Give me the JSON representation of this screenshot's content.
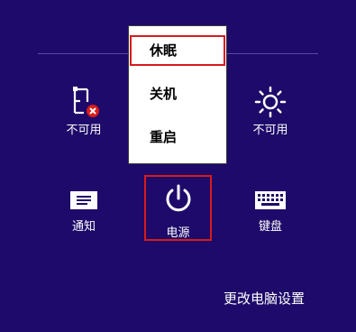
{
  "colors": {
    "background": "#1e0a6a",
    "highlight_border": "#d81b1b",
    "menu_bg": "#ffffff"
  },
  "tiles": {
    "network": {
      "label": "不可用",
      "icon": "network-unavailable-icon"
    },
    "brightness": {
      "label": "不可用",
      "icon": "brightness-icon"
    },
    "notifications": {
      "label": "通知",
      "icon": "notifications-icon"
    },
    "power": {
      "label": "电源",
      "icon": "power-icon"
    },
    "keyboard": {
      "label": "键盘",
      "icon": "keyboard-icon"
    }
  },
  "power_menu": {
    "items": [
      {
        "label": "休眠",
        "selected": true
      },
      {
        "label": "关机",
        "selected": false
      },
      {
        "label": "重启",
        "selected": false
      }
    ]
  },
  "settings_link": "更改电脑设置"
}
